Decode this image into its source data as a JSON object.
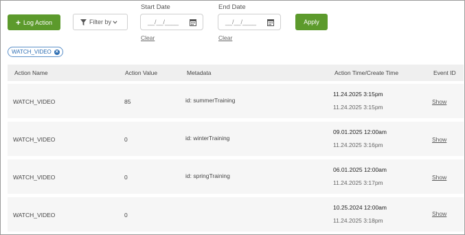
{
  "toolbar": {
    "log_action_label": "Log Action",
    "filter_label": "Filter by",
    "apply_label": "Apply",
    "accent_color": "#5c9a2c"
  },
  "start_date": {
    "label": "Start Date",
    "placeholder": "__/__/____",
    "clear_label": "Clear"
  },
  "end_date": {
    "label": "End Date",
    "placeholder": "__/__/____",
    "clear_label": "Clear"
  },
  "active_filter": {
    "label": "WATCH_VIDEO"
  },
  "table": {
    "columns": [
      "Action Name",
      "Action Value",
      "Metadata",
      "Action Time/Create Time",
      "Event ID"
    ],
    "rows": [
      {
        "action_name": "WATCH_VIDEO",
        "action_value": "85",
        "metadata": "id: summerTraining",
        "action_time": "11.24.2025 3:15pm",
        "create_time": "11.24.2025 3:15pm",
        "event_id": "Show"
      },
      {
        "action_name": "WATCH_VIDEO",
        "action_value": "0",
        "metadata": "id: winterTraining",
        "action_time": "09.01.2025 12:00am",
        "create_time": "11.24.2025 3:16pm",
        "event_id": "Show"
      },
      {
        "action_name": "WATCH_VIDEO",
        "action_value": "0",
        "metadata": "id: springTraining",
        "action_time": "06.01.2025 12:00am",
        "create_time": "11.24.2025 3:17pm",
        "event_id": "Show"
      },
      {
        "action_name": "WATCH_VIDEO",
        "action_value": "0",
        "metadata": "",
        "action_time": "10.25.2024 12:00am",
        "create_time": "11.24.2025 3:18pm",
        "event_id": "Show"
      }
    ]
  }
}
